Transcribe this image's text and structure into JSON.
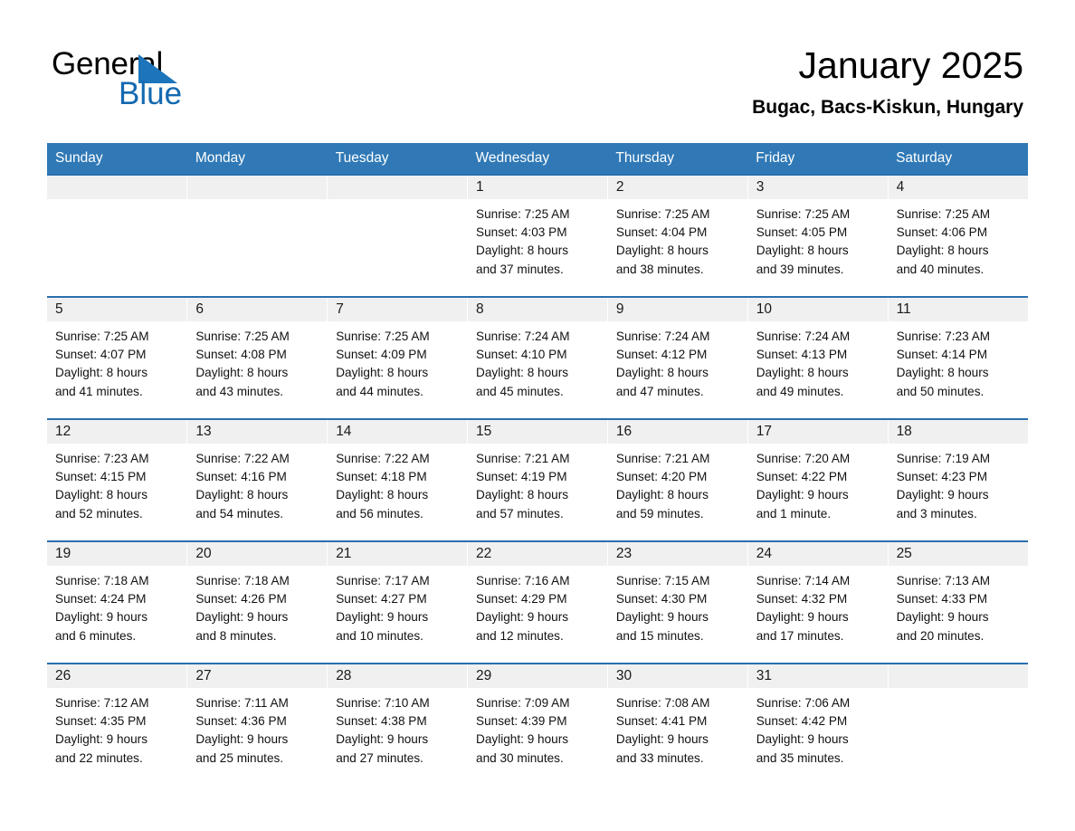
{
  "brand": {
    "line1": "General",
    "line2": "Blue",
    "triangle_color": "#1c74bb",
    "blue_text_color": "#1469b0"
  },
  "header": {
    "title": "January 2025",
    "subtitle": "Bugac, Bacs-Kiskun, Hungary"
  },
  "theme": {
    "header_row_bg": "#3079b6",
    "header_row_text": "#ffffff",
    "week_rule": "#2a6fae",
    "daynum_bg": "#f0f0f0"
  },
  "weekday_headers": [
    "Sunday",
    "Monday",
    "Tuesday",
    "Wednesday",
    "Thursday",
    "Friday",
    "Saturday"
  ],
  "weeks": [
    [
      {
        "day": "",
        "lines": []
      },
      {
        "day": "",
        "lines": []
      },
      {
        "day": "",
        "lines": []
      },
      {
        "day": "1",
        "lines": [
          "Sunrise: 7:25 AM",
          "Sunset: 4:03 PM",
          "Daylight: 8 hours",
          "and 37 minutes."
        ]
      },
      {
        "day": "2",
        "lines": [
          "Sunrise: 7:25 AM",
          "Sunset: 4:04 PM",
          "Daylight: 8 hours",
          "and 38 minutes."
        ]
      },
      {
        "day": "3",
        "lines": [
          "Sunrise: 7:25 AM",
          "Sunset: 4:05 PM",
          "Daylight: 8 hours",
          "and 39 minutes."
        ]
      },
      {
        "day": "4",
        "lines": [
          "Sunrise: 7:25 AM",
          "Sunset: 4:06 PM",
          "Daylight: 8 hours",
          "and 40 minutes."
        ]
      }
    ],
    [
      {
        "day": "5",
        "lines": [
          "Sunrise: 7:25 AM",
          "Sunset: 4:07 PM",
          "Daylight: 8 hours",
          "and 41 minutes."
        ]
      },
      {
        "day": "6",
        "lines": [
          "Sunrise: 7:25 AM",
          "Sunset: 4:08 PM",
          "Daylight: 8 hours",
          "and 43 minutes."
        ]
      },
      {
        "day": "7",
        "lines": [
          "Sunrise: 7:25 AM",
          "Sunset: 4:09 PM",
          "Daylight: 8 hours",
          "and 44 minutes."
        ]
      },
      {
        "day": "8",
        "lines": [
          "Sunrise: 7:24 AM",
          "Sunset: 4:10 PM",
          "Daylight: 8 hours",
          "and 45 minutes."
        ]
      },
      {
        "day": "9",
        "lines": [
          "Sunrise: 7:24 AM",
          "Sunset: 4:12 PM",
          "Daylight: 8 hours",
          "and 47 minutes."
        ]
      },
      {
        "day": "10",
        "lines": [
          "Sunrise: 7:24 AM",
          "Sunset: 4:13 PM",
          "Daylight: 8 hours",
          "and 49 minutes."
        ]
      },
      {
        "day": "11",
        "lines": [
          "Sunrise: 7:23 AM",
          "Sunset: 4:14 PM",
          "Daylight: 8 hours",
          "and 50 minutes."
        ]
      }
    ],
    [
      {
        "day": "12",
        "lines": [
          "Sunrise: 7:23 AM",
          "Sunset: 4:15 PM",
          "Daylight: 8 hours",
          "and 52 minutes."
        ]
      },
      {
        "day": "13",
        "lines": [
          "Sunrise: 7:22 AM",
          "Sunset: 4:16 PM",
          "Daylight: 8 hours",
          "and 54 minutes."
        ]
      },
      {
        "day": "14",
        "lines": [
          "Sunrise: 7:22 AM",
          "Sunset: 4:18 PM",
          "Daylight: 8 hours",
          "and 56 minutes."
        ]
      },
      {
        "day": "15",
        "lines": [
          "Sunrise: 7:21 AM",
          "Sunset: 4:19 PM",
          "Daylight: 8 hours",
          "and 57 minutes."
        ]
      },
      {
        "day": "16",
        "lines": [
          "Sunrise: 7:21 AM",
          "Sunset: 4:20 PM",
          "Daylight: 8 hours",
          "and 59 minutes."
        ]
      },
      {
        "day": "17",
        "lines": [
          "Sunrise: 7:20 AM",
          "Sunset: 4:22 PM",
          "Daylight: 9 hours",
          "and 1 minute."
        ]
      },
      {
        "day": "18",
        "lines": [
          "Sunrise: 7:19 AM",
          "Sunset: 4:23 PM",
          "Daylight: 9 hours",
          "and 3 minutes."
        ]
      }
    ],
    [
      {
        "day": "19",
        "lines": [
          "Sunrise: 7:18 AM",
          "Sunset: 4:24 PM",
          "Daylight: 9 hours",
          "and 6 minutes."
        ]
      },
      {
        "day": "20",
        "lines": [
          "Sunrise: 7:18 AM",
          "Sunset: 4:26 PM",
          "Daylight: 9 hours",
          "and 8 minutes."
        ]
      },
      {
        "day": "21",
        "lines": [
          "Sunrise: 7:17 AM",
          "Sunset: 4:27 PM",
          "Daylight: 9 hours",
          "and 10 minutes."
        ]
      },
      {
        "day": "22",
        "lines": [
          "Sunrise: 7:16 AM",
          "Sunset: 4:29 PM",
          "Daylight: 9 hours",
          "and 12 minutes."
        ]
      },
      {
        "day": "23",
        "lines": [
          "Sunrise: 7:15 AM",
          "Sunset: 4:30 PM",
          "Daylight: 9 hours",
          "and 15 minutes."
        ]
      },
      {
        "day": "24",
        "lines": [
          "Sunrise: 7:14 AM",
          "Sunset: 4:32 PM",
          "Daylight: 9 hours",
          "and 17 minutes."
        ]
      },
      {
        "day": "25",
        "lines": [
          "Sunrise: 7:13 AM",
          "Sunset: 4:33 PM",
          "Daylight: 9 hours",
          "and 20 minutes."
        ]
      }
    ],
    [
      {
        "day": "26",
        "lines": [
          "Sunrise: 7:12 AM",
          "Sunset: 4:35 PM",
          "Daylight: 9 hours",
          "and 22 minutes."
        ]
      },
      {
        "day": "27",
        "lines": [
          "Sunrise: 7:11 AM",
          "Sunset: 4:36 PM",
          "Daylight: 9 hours",
          "and 25 minutes."
        ]
      },
      {
        "day": "28",
        "lines": [
          "Sunrise: 7:10 AM",
          "Sunset: 4:38 PM",
          "Daylight: 9 hours",
          "and 27 minutes."
        ]
      },
      {
        "day": "29",
        "lines": [
          "Sunrise: 7:09 AM",
          "Sunset: 4:39 PM",
          "Daylight: 9 hours",
          "and 30 minutes."
        ]
      },
      {
        "day": "30",
        "lines": [
          "Sunrise: 7:08 AM",
          "Sunset: 4:41 PM",
          "Daylight: 9 hours",
          "and 33 minutes."
        ]
      },
      {
        "day": "31",
        "lines": [
          "Sunrise: 7:06 AM",
          "Sunset: 4:42 PM",
          "Daylight: 9 hours",
          "and 35 minutes."
        ]
      },
      {
        "day": "",
        "lines": []
      }
    ]
  ]
}
